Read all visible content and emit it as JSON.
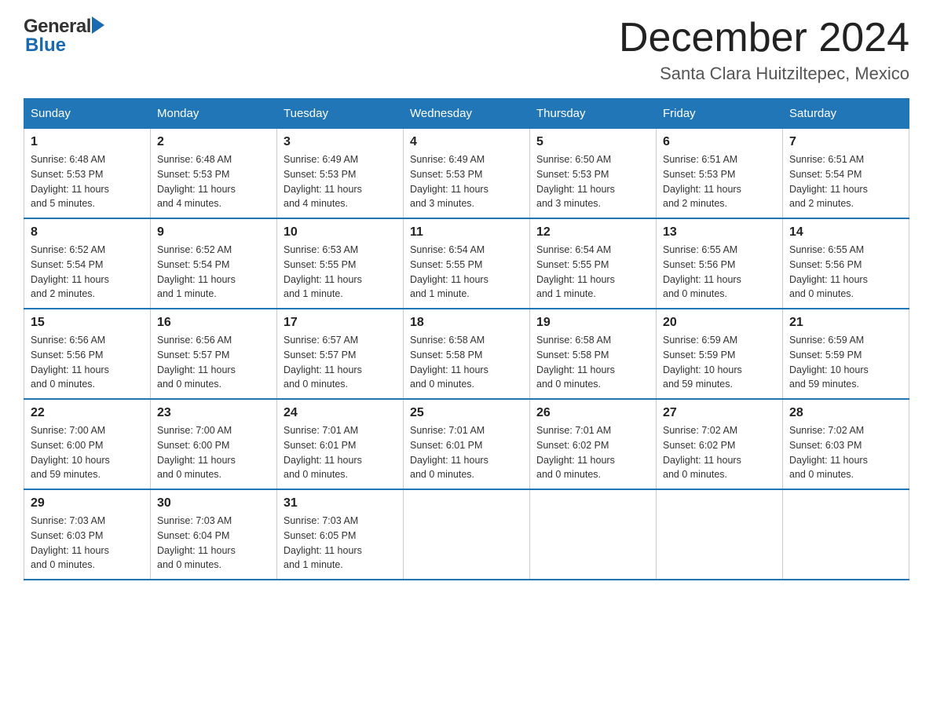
{
  "header": {
    "logo_general": "General",
    "logo_blue": "Blue",
    "title": "December 2024",
    "subtitle": "Santa Clara Huitziltepec, Mexico"
  },
  "days_of_week": [
    "Sunday",
    "Monday",
    "Tuesday",
    "Wednesday",
    "Thursday",
    "Friday",
    "Saturday"
  ],
  "weeks": [
    [
      {
        "day": "1",
        "info": "Sunrise: 6:48 AM\nSunset: 5:53 PM\nDaylight: 11 hours\nand 5 minutes."
      },
      {
        "day": "2",
        "info": "Sunrise: 6:48 AM\nSunset: 5:53 PM\nDaylight: 11 hours\nand 4 minutes."
      },
      {
        "day": "3",
        "info": "Sunrise: 6:49 AM\nSunset: 5:53 PM\nDaylight: 11 hours\nand 4 minutes."
      },
      {
        "day": "4",
        "info": "Sunrise: 6:49 AM\nSunset: 5:53 PM\nDaylight: 11 hours\nand 3 minutes."
      },
      {
        "day": "5",
        "info": "Sunrise: 6:50 AM\nSunset: 5:53 PM\nDaylight: 11 hours\nand 3 minutes."
      },
      {
        "day": "6",
        "info": "Sunrise: 6:51 AM\nSunset: 5:53 PM\nDaylight: 11 hours\nand 2 minutes."
      },
      {
        "day": "7",
        "info": "Sunrise: 6:51 AM\nSunset: 5:54 PM\nDaylight: 11 hours\nand 2 minutes."
      }
    ],
    [
      {
        "day": "8",
        "info": "Sunrise: 6:52 AM\nSunset: 5:54 PM\nDaylight: 11 hours\nand 2 minutes."
      },
      {
        "day": "9",
        "info": "Sunrise: 6:52 AM\nSunset: 5:54 PM\nDaylight: 11 hours\nand 1 minute."
      },
      {
        "day": "10",
        "info": "Sunrise: 6:53 AM\nSunset: 5:55 PM\nDaylight: 11 hours\nand 1 minute."
      },
      {
        "day": "11",
        "info": "Sunrise: 6:54 AM\nSunset: 5:55 PM\nDaylight: 11 hours\nand 1 minute."
      },
      {
        "day": "12",
        "info": "Sunrise: 6:54 AM\nSunset: 5:55 PM\nDaylight: 11 hours\nand 1 minute."
      },
      {
        "day": "13",
        "info": "Sunrise: 6:55 AM\nSunset: 5:56 PM\nDaylight: 11 hours\nand 0 minutes."
      },
      {
        "day": "14",
        "info": "Sunrise: 6:55 AM\nSunset: 5:56 PM\nDaylight: 11 hours\nand 0 minutes."
      }
    ],
    [
      {
        "day": "15",
        "info": "Sunrise: 6:56 AM\nSunset: 5:56 PM\nDaylight: 11 hours\nand 0 minutes."
      },
      {
        "day": "16",
        "info": "Sunrise: 6:56 AM\nSunset: 5:57 PM\nDaylight: 11 hours\nand 0 minutes."
      },
      {
        "day": "17",
        "info": "Sunrise: 6:57 AM\nSunset: 5:57 PM\nDaylight: 11 hours\nand 0 minutes."
      },
      {
        "day": "18",
        "info": "Sunrise: 6:58 AM\nSunset: 5:58 PM\nDaylight: 11 hours\nand 0 minutes."
      },
      {
        "day": "19",
        "info": "Sunrise: 6:58 AM\nSunset: 5:58 PM\nDaylight: 11 hours\nand 0 minutes."
      },
      {
        "day": "20",
        "info": "Sunrise: 6:59 AM\nSunset: 5:59 PM\nDaylight: 10 hours\nand 59 minutes."
      },
      {
        "day": "21",
        "info": "Sunrise: 6:59 AM\nSunset: 5:59 PM\nDaylight: 10 hours\nand 59 minutes."
      }
    ],
    [
      {
        "day": "22",
        "info": "Sunrise: 7:00 AM\nSunset: 6:00 PM\nDaylight: 10 hours\nand 59 minutes."
      },
      {
        "day": "23",
        "info": "Sunrise: 7:00 AM\nSunset: 6:00 PM\nDaylight: 11 hours\nand 0 minutes."
      },
      {
        "day": "24",
        "info": "Sunrise: 7:01 AM\nSunset: 6:01 PM\nDaylight: 11 hours\nand 0 minutes."
      },
      {
        "day": "25",
        "info": "Sunrise: 7:01 AM\nSunset: 6:01 PM\nDaylight: 11 hours\nand 0 minutes."
      },
      {
        "day": "26",
        "info": "Sunrise: 7:01 AM\nSunset: 6:02 PM\nDaylight: 11 hours\nand 0 minutes."
      },
      {
        "day": "27",
        "info": "Sunrise: 7:02 AM\nSunset: 6:02 PM\nDaylight: 11 hours\nand 0 minutes."
      },
      {
        "day": "28",
        "info": "Sunrise: 7:02 AM\nSunset: 6:03 PM\nDaylight: 11 hours\nand 0 minutes."
      }
    ],
    [
      {
        "day": "29",
        "info": "Sunrise: 7:03 AM\nSunset: 6:03 PM\nDaylight: 11 hours\nand 0 minutes."
      },
      {
        "day": "30",
        "info": "Sunrise: 7:03 AM\nSunset: 6:04 PM\nDaylight: 11 hours\nand 0 minutes."
      },
      {
        "day": "31",
        "info": "Sunrise: 7:03 AM\nSunset: 6:05 PM\nDaylight: 11 hours\nand 1 minute."
      },
      {
        "day": "",
        "info": ""
      },
      {
        "day": "",
        "info": ""
      },
      {
        "day": "",
        "info": ""
      },
      {
        "day": "",
        "info": ""
      }
    ]
  ]
}
